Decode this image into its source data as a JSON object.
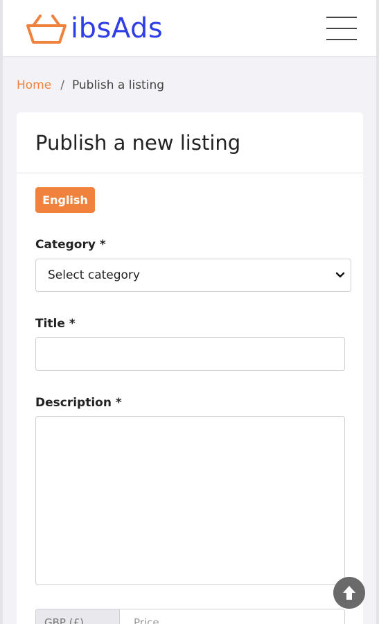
{
  "app": {
    "brand": "ibsAds",
    "brand_color": "#2f3ee6",
    "accent_color": "#f0823e"
  },
  "header": {
    "logo_icon": "basket-icon",
    "menu_icon": "hamburger-menu-icon"
  },
  "breadcrumb": {
    "home_label": "Home",
    "separator": "/",
    "current_label": "Publish a listing"
  },
  "form": {
    "title": "Publish a new listing",
    "language_badge": "English",
    "category": {
      "label": "Category *",
      "selected": "Select category"
    },
    "title_field": {
      "label": "Title *",
      "value": ""
    },
    "description_field": {
      "label": "Description *",
      "value": ""
    },
    "price_field": {
      "currency_addon": "GBP (£)",
      "placeholder": "Price"
    }
  },
  "scroll_top_icon": "arrow-up-icon"
}
